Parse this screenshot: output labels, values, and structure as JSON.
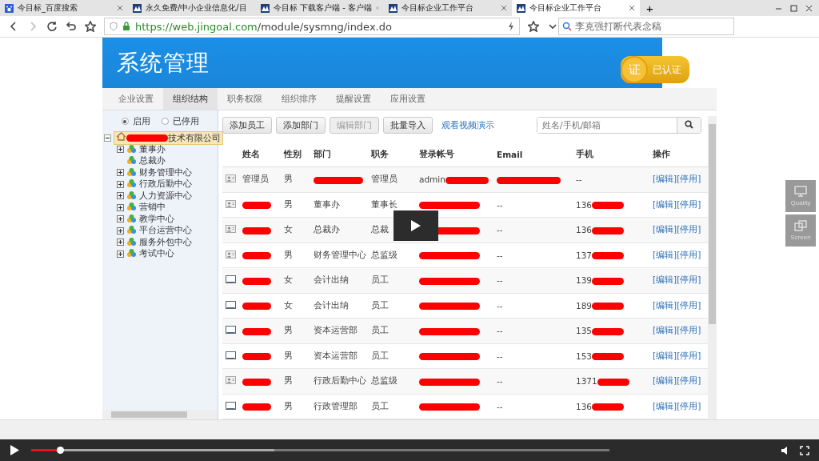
{
  "browser_tabs": [
    {
      "title": "今目标_百度搜索",
      "kind": "paw",
      "selected": false
    },
    {
      "title": "永久免费/中小企业信息化/目",
      "kind": "logo",
      "selected": false
    },
    {
      "title": "今目标 下载客户端 - 客户端",
      "kind": "logo",
      "selected": false
    },
    {
      "title": "今目标企业工作平台",
      "kind": "logo",
      "selected": false
    },
    {
      "title": "今目标企业工作平台",
      "kind": "logo",
      "selected": true
    }
  ],
  "new_tab": "+",
  "address_bar": {
    "url_host": "https://web.jingoal.com",
    "url_path": "/module/sysmng/index.do",
    "search_value": "李克强打断代表念稿"
  },
  "header": {
    "title": "系统管理",
    "badge_seal": "证",
    "badge_text": "已认证"
  },
  "nav_tabs": [
    {
      "label": "企业设置",
      "selected": false
    },
    {
      "label": "组织结构",
      "selected": true
    },
    {
      "label": "职务权限",
      "selected": false
    },
    {
      "label": "组织排序",
      "selected": false
    },
    {
      "label": "提醒设置",
      "selected": false
    },
    {
      "label": "应用设置",
      "selected": false
    }
  ],
  "status_filter": [
    {
      "label": "启用",
      "selected": true
    },
    {
      "label": "已停用",
      "selected": false
    }
  ],
  "tree": {
    "label": "技术有限公司",
    "expanded": true,
    "children": [
      {
        "label": "董事办",
        "kind": "branch"
      },
      {
        "label": "总裁办",
        "kind": "leaf"
      },
      {
        "label": "财务管理中心",
        "kind": "branch"
      },
      {
        "label": "行政后勤中心",
        "kind": "branch"
      },
      {
        "label": "人力资源中心",
        "kind": "branch"
      },
      {
        "label": "营销中",
        "kind": "branch"
      },
      {
        "label": "教学中心",
        "kind": "branch"
      },
      {
        "label": "平台运营中心",
        "kind": "branch"
      },
      {
        "label": "服务外包中心",
        "kind": "branch"
      },
      {
        "label": "考试中心",
        "kind": "branch"
      }
    ]
  },
  "toolbar": {
    "buttons": [
      {
        "label": "添加员工",
        "disabled": false
      },
      {
        "label": "添加部门",
        "disabled": false
      },
      {
        "label": "编辑部门",
        "disabled": true
      },
      {
        "label": "批量导入",
        "disabled": false
      }
    ],
    "video_link": "观看视频演示",
    "search_placeholder": "姓名/手机/邮箱"
  },
  "table": {
    "columns": [
      "姓名",
      "性别",
      "部门",
      "职务",
      "登录帐号",
      "Email",
      "手机",
      "操作"
    ],
    "rows": [
      {
        "kind": "card",
        "name": "管理员",
        "gender": "男",
        "department": "",
        "title": "管理员",
        "account": "admin",
        "email": "",
        "phone": "--",
        "actions": [
          "[编辑]",
          "[停用]"
        ]
      },
      {
        "kind": "card",
        "name": "",
        "gender": "男",
        "department": "董事办",
        "title": "董事长",
        "account": "",
        "email": "--",
        "phone": "136",
        "actions": [
          "[编辑]",
          "[停用]"
        ]
      },
      {
        "kind": "card",
        "name": "",
        "gender": "女",
        "department": "总裁办",
        "title": "总裁",
        "account": "",
        "email": "--",
        "phone": "136",
        "actions": [
          "[编辑]",
          "[停用]"
        ]
      },
      {
        "kind": "card",
        "name": "",
        "gender": "男",
        "department": "财务管理中心",
        "title": "总监级",
        "account": "",
        "email": "--",
        "phone": "137",
        "actions": [
          "[编辑]",
          "[停用]"
        ]
      },
      {
        "kind": "screen",
        "name": "",
        "gender": "女",
        "department": "会计出纳",
        "title": "员工",
        "account": "",
        "email": "--",
        "phone": "139",
        "actions": [
          "[编辑]",
          "[停用]"
        ]
      },
      {
        "kind": "screen",
        "name": "",
        "gender": "女",
        "department": "会计出纳",
        "title": "员工",
        "account": "",
        "email": "--",
        "phone": "189",
        "actions": [
          "[编辑]",
          "[停用]"
        ]
      },
      {
        "kind": "screen",
        "name": "",
        "gender": "男",
        "department": "资本运营部",
        "title": "员工",
        "account": "",
        "email": "--",
        "phone": "135",
        "actions": [
          "[编辑]",
          "[停用]"
        ]
      },
      {
        "kind": "screen",
        "name": "",
        "gender": "男",
        "department": "资本运营部",
        "title": "员工",
        "account": "",
        "email": "--",
        "phone": "153",
        "actions": [
          "[编辑]",
          "[停用]"
        ]
      },
      {
        "kind": "card",
        "name": "",
        "gender": "男",
        "department": "行政后勤中心",
        "title": "总监级",
        "account": "",
        "email": "--",
        "phone": "1371",
        "actions": [
          "[编辑]",
          "[停用]"
        ]
      },
      {
        "kind": "screen",
        "name": "",
        "gender": "男",
        "department": "行政管理部",
        "title": "员工",
        "account": "",
        "email": "--",
        "phone": "136",
        "actions": [
          "[编辑]",
          "[停用]"
        ]
      }
    ]
  },
  "side_panel": [
    {
      "label": "Quality",
      "kind": "monitor"
    },
    {
      "label": "Screen",
      "kind": "windows"
    }
  ],
  "player": {
    "progress": {
      "level": 0.05
    },
    "buffered": {
      "level": 0.42
    }
  }
}
